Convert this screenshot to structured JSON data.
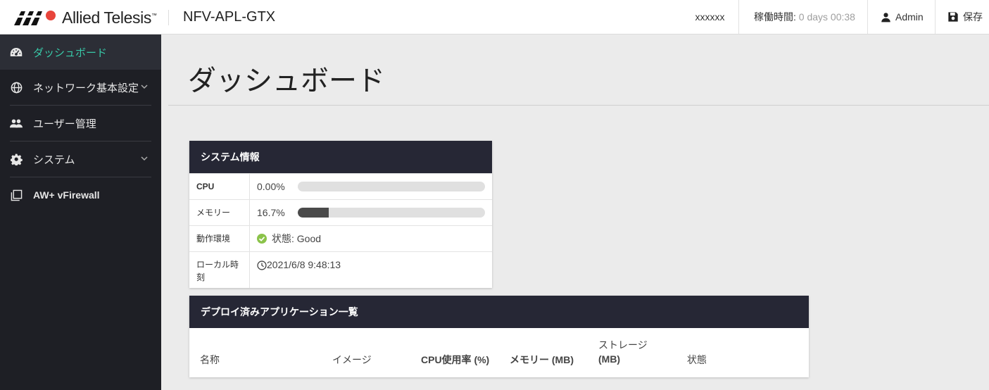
{
  "header": {
    "brand": "Allied Telesis",
    "brand_tm": "™",
    "device_name": "NFV-APL-GTX",
    "user": "xxxxxx",
    "uptime_label": "稼働時間:",
    "uptime_value": "0 days 00:38",
    "admin_label": "Admin",
    "save_label": "保存"
  },
  "sidebar": {
    "items": [
      {
        "label": "ダッシュボード",
        "icon": "dashboard-icon",
        "active": true
      },
      {
        "label": "ネットワーク基本設定",
        "icon": "globe-icon",
        "expandable": true
      },
      {
        "label": "ユーザー管理",
        "icon": "users-icon"
      },
      {
        "label": "システム",
        "icon": "gear-icon",
        "expandable": true
      },
      {
        "label": "AW+ vFirewall",
        "icon": "windows-icon"
      }
    ]
  },
  "main": {
    "title": "ダッシュボード",
    "system_card": {
      "title": "システム情報",
      "cpu_label": "CPU",
      "cpu_value": "0.00%",
      "cpu_level": 0.0,
      "memory_label": "メモリー",
      "memory_value": "16.7%",
      "memory_level": 0.167,
      "env_label": "動作環境",
      "env_value": "状態: Good",
      "time_label": "ローカル時刻",
      "time_value": "2021/6/8 9:48:13"
    },
    "deploy_card": {
      "title": "デプロイ済みアプリケーション一覧",
      "columns": [
        "名称",
        "イメージ",
        "CPU使用率 (%)",
        "メモリー (MB)",
        "ストレージ",
        "(MB)",
        "状態"
      ]
    }
  },
  "colors": {
    "accent": "#38c9a8",
    "sidebar_bg": "#1e1f25",
    "card_header_bg": "#262735",
    "status_good": "#8bc34a",
    "logo_red": "#e8453c"
  }
}
